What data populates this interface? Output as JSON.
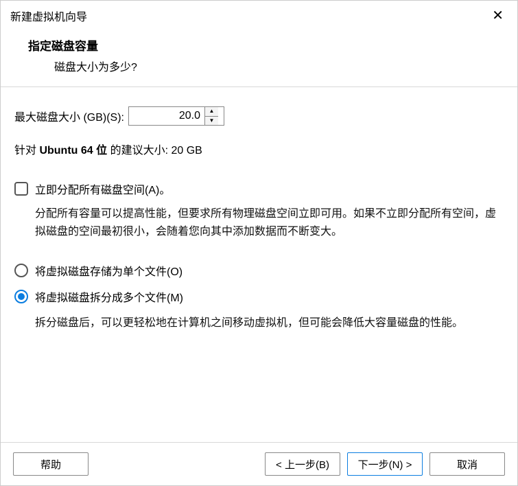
{
  "window": {
    "title": "新建虚拟机向导"
  },
  "header": {
    "title": "指定磁盘容量",
    "subtitle": "磁盘大小为多少?"
  },
  "disk_size": {
    "label": "最大磁盘大小 (GB)(S):",
    "value": "20.0"
  },
  "recommended": {
    "prefix": "针对 ",
    "os": "Ubuntu 64 位",
    "mid": " 的建议大小: ",
    "size": "20 GB"
  },
  "allocate_now": {
    "label": "立即分配所有磁盘空间(A)。",
    "checked": false,
    "desc": "分配所有容量可以提高性能，但要求所有物理磁盘空间立即可用。如果不立即分配所有空间，虚拟磁盘的空间最初很小，会随着您向其中添加数据而不断变大。"
  },
  "file_option": {
    "single": {
      "label": "将虚拟磁盘存储为单个文件(O)",
      "checked": false
    },
    "split": {
      "label": "将虚拟磁盘拆分成多个文件(M)",
      "checked": true,
      "desc": "拆分磁盘后，可以更轻松地在计算机之间移动虚拟机，但可能会降低大容量磁盘的性能。"
    }
  },
  "buttons": {
    "help": "帮助",
    "back": "< 上一步(B)",
    "next": "下一步(N) >",
    "cancel": "取消"
  }
}
